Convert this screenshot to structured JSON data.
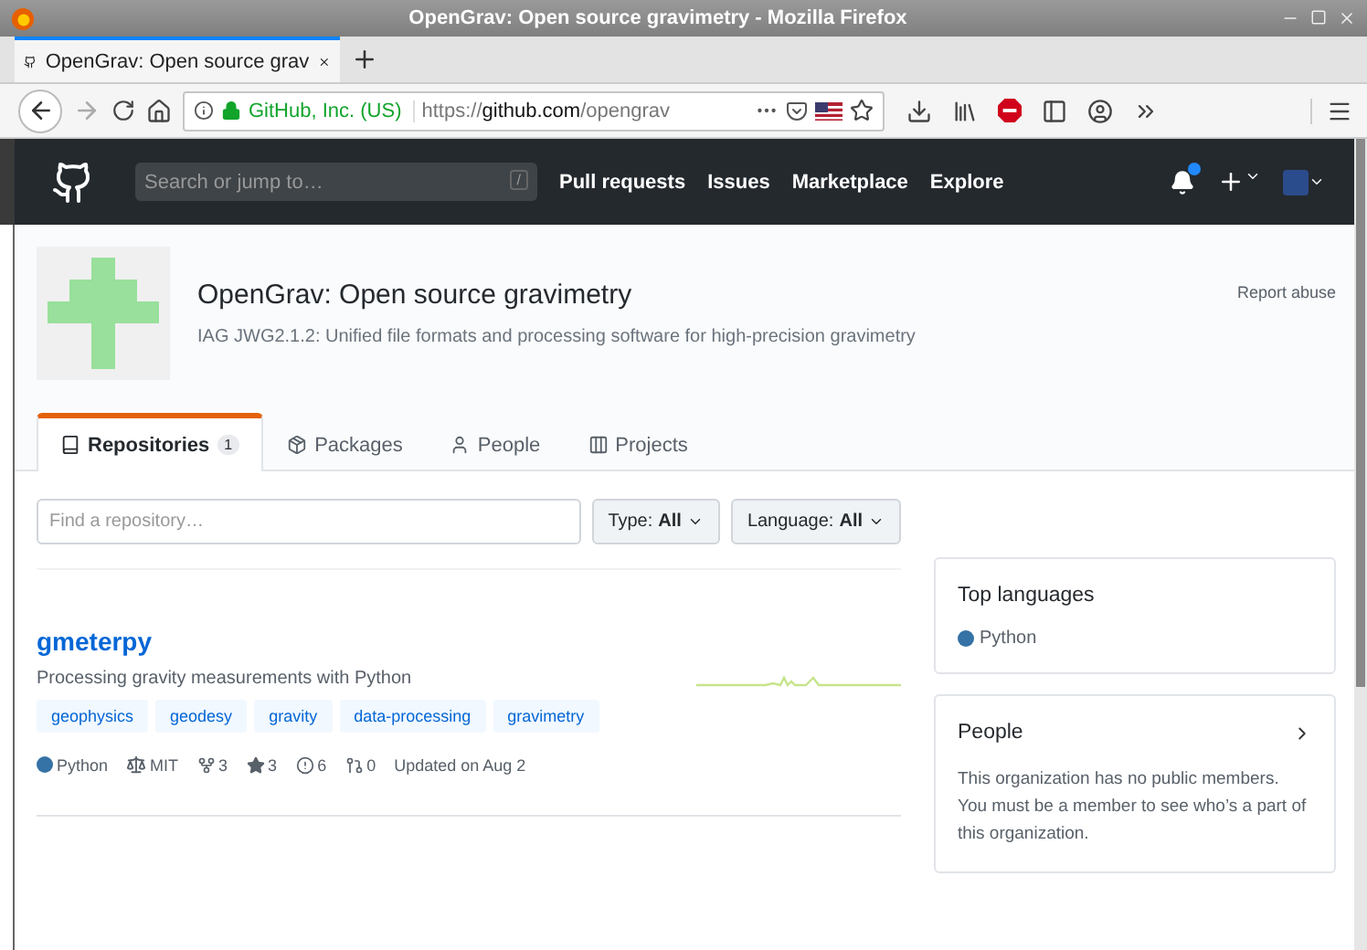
{
  "window": {
    "title": "OpenGrav: Open source gravimetry - Mozilla Firefox"
  },
  "browser_tabs": [
    {
      "label": "OpenGrav: Open source grav",
      "selected": true
    }
  ],
  "address_bar": {
    "identity": "GitHub, Inc. (US)",
    "url_prefix": "https://",
    "url_host": "github.com",
    "url_path": "/opengrav"
  },
  "header": {
    "search_placeholder": "Search or jump to…",
    "search_key": "/",
    "nav": [
      "Pull requests",
      "Issues",
      "Marketplace",
      "Explore"
    ],
    "notification": true
  },
  "org": {
    "name": "OpenGrav: Open source gravimetry",
    "description": "IAG JWG2.1.2: Unified file formats and processing software for high-precision gravimetry",
    "report": "Report abuse"
  },
  "tabs": [
    {
      "kind": "repositories",
      "label": "Repositories",
      "count": "1",
      "selected": true
    },
    {
      "kind": "packages",
      "label": "Packages",
      "selected": false
    },
    {
      "kind": "people",
      "label": "People",
      "selected": false
    },
    {
      "kind": "projects",
      "label": "Projects",
      "selected": false
    }
  ],
  "filter": {
    "placeholder": "Find a repository…",
    "type_label": "Type:",
    "type_value": "All",
    "language_label": "Language:",
    "language_value": "All"
  },
  "repos": [
    {
      "name": "gmeterpy",
      "description": "Processing gravity measurements with Python",
      "topics": [
        "geophysics",
        "geodesy",
        "gravity",
        "data-processing",
        "gravimetry"
      ],
      "language": "Python",
      "color": "#3572a5",
      "license": "MIT",
      "forks": "3",
      "stars": "3",
      "issues": "6",
      "pulls": "0",
      "updated": "Updated on Aug 2"
    }
  ],
  "top_languages": {
    "title": "Top languages",
    "items": [
      {
        "name": "Python",
        "color": "#3572a5"
      }
    ]
  },
  "people": {
    "title": "People",
    "text": "This organization has no public members. You must be a member to see who’s a part of this organization."
  }
}
